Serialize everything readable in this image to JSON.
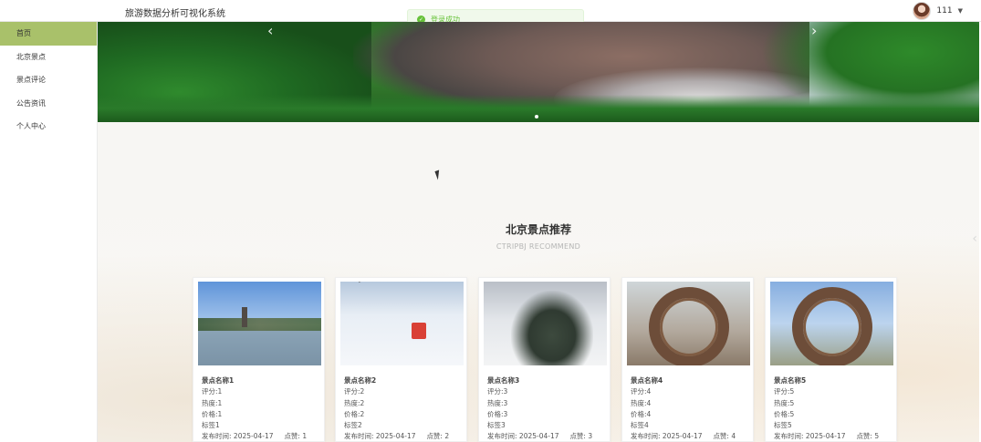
{
  "app": {
    "title": "旅游数据分析可视化系统"
  },
  "user": {
    "name": "111"
  },
  "toast": {
    "message": "登录成功"
  },
  "sidebar": {
    "items": [
      {
        "label": "首页",
        "active": true
      },
      {
        "label": "北京景点",
        "active": false
      },
      {
        "label": "景点评论",
        "active": false
      },
      {
        "label": "公告资讯",
        "active": false
      },
      {
        "label": "个人中心",
        "active": false
      }
    ]
  },
  "section": {
    "title": "北京景点推荐",
    "subtitle": "CTRIPBJ RECOMMEND"
  },
  "cards": [
    {
      "name": "景点名称1",
      "rating": "评分:1",
      "heat": "热度:1",
      "price": "价格:1",
      "tag": "标签1",
      "time_label": "发布时间:",
      "date": "2025-04-17",
      "likes_label": "点赞:",
      "likes": "1"
    },
    {
      "name": "景点名称2",
      "rating": "评分:2",
      "heat": "热度:2",
      "price": "价格:2",
      "tag": "标签2",
      "time_label": "发布时间:",
      "date": "2025-04-17",
      "likes_label": "点赞:",
      "likes": "2"
    },
    {
      "name": "景点名称3",
      "rating": "评分:3",
      "heat": "热度:3",
      "price": "价格:3",
      "tag": "标签3",
      "time_label": "发布时间:",
      "date": "2025-04-17",
      "likes_label": "点赞:",
      "likes": "3"
    },
    {
      "name": "景点名称4",
      "rating": "评分:4",
      "heat": "热度:4",
      "price": "价格:4",
      "tag": "标签4",
      "time_label": "发布时间:",
      "date": "2025-04-17",
      "likes_label": "点赞:",
      "likes": "4"
    },
    {
      "name": "景点名称5",
      "rating": "评分:5",
      "heat": "热度:5",
      "price": "价格:5",
      "tag": "标签5",
      "time_label": "发布时间:",
      "date": "2025-04-17",
      "likes_label": "点赞:",
      "likes": "5"
    }
  ],
  "colors": {
    "accent": "#a9c16a",
    "toast_bg": "#f0f9eb",
    "toast_text": "#67c23a"
  },
  "icons": {
    "success": "check-circle-icon",
    "dropdown": "caret-down-icon",
    "prev": "chevron-left-icon",
    "next": "chevron-right-icon"
  }
}
